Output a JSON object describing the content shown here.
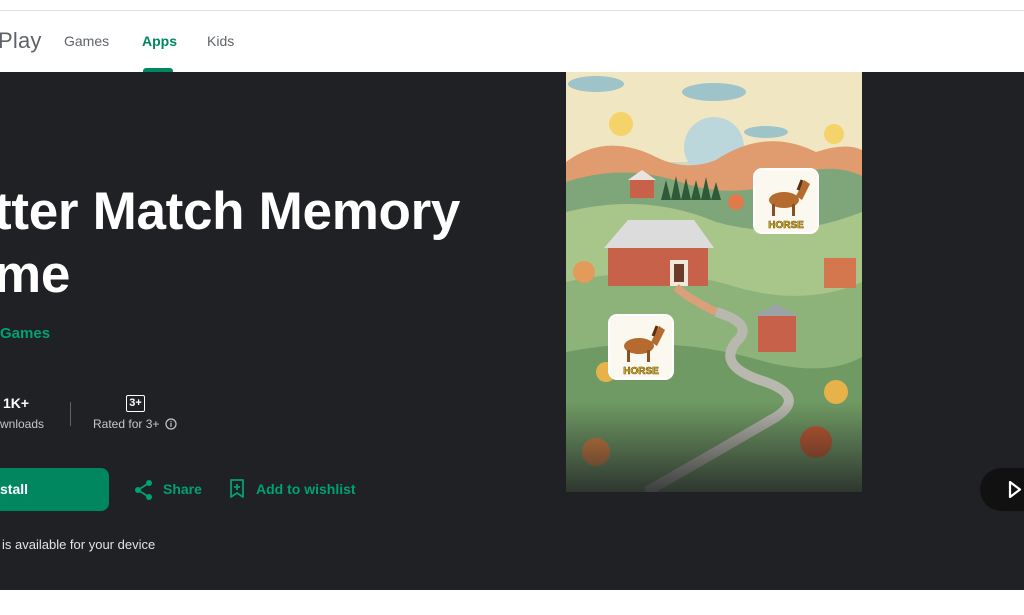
{
  "header": {
    "logo_text": "Play",
    "nav": [
      {
        "label": "Games",
        "active": false
      },
      {
        "label": "Apps",
        "active": true
      },
      {
        "label": "Kids",
        "active": false
      }
    ]
  },
  "app": {
    "title_line1": "tter Match Memory",
    "title_line2": "me",
    "developer": "Games",
    "stats": {
      "downloads_value": "1K+",
      "downloads_label": "wnloads",
      "rating_badge": "3+",
      "rating_label": "Rated for 3+"
    },
    "install_label": "stall",
    "share_label": "Share",
    "wishlist_label": "Add to wishlist",
    "availability": "is available for your device"
  },
  "screenshot": {
    "card_labels": [
      "HORSE",
      "HORSE"
    ]
  },
  "colors": {
    "accent": "#01875f",
    "hero_bg": "#202124"
  },
  "icons": {
    "share": "share-icon",
    "wishlist": "bookmark-add-icon",
    "info": "info-icon",
    "play": "play-icon"
  }
}
